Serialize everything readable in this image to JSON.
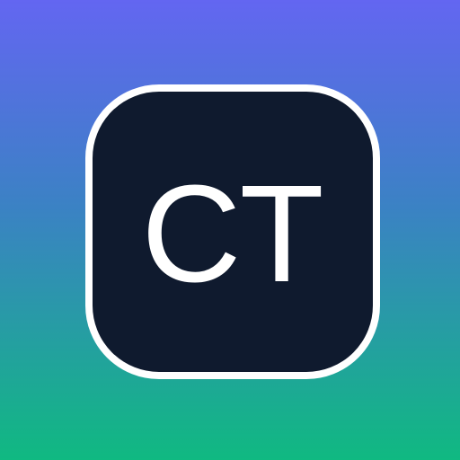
{
  "icon": {
    "monogram": "CT",
    "colors": {
      "gradient_top": "#6366f1",
      "gradient_bottom": "#10b981",
      "badge_fill": "#0f1a2e",
      "badge_border": "#ffffff",
      "text": "#ffffff"
    }
  }
}
